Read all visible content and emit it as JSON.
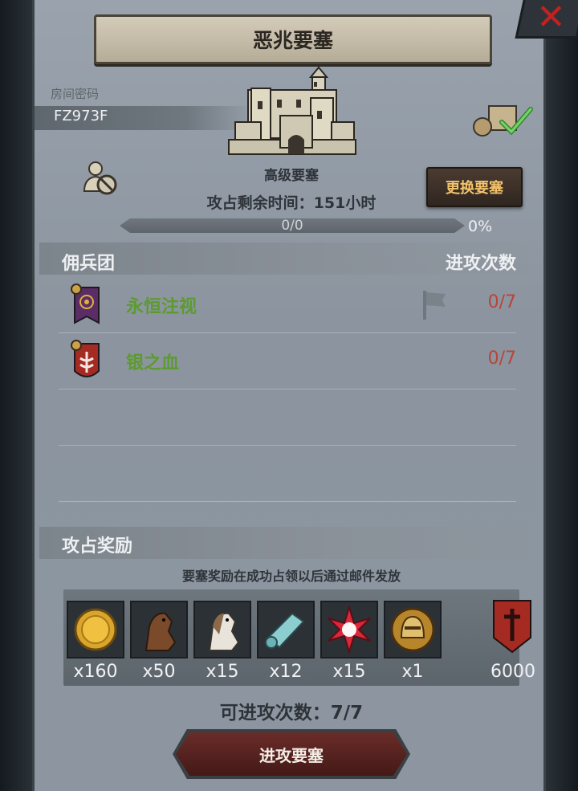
{
  "dialog": {
    "title": "恶兆要塞",
    "room_label": "房间密码",
    "room_code": "FZ973F",
    "fort_name": "高级要塞",
    "remaining_time": "攻占剩余时间：151小时",
    "change_button": "更换要塞",
    "progress_text": "0/0",
    "progress_percent": "0%",
    "progress_fraction": 0
  },
  "mercenaries": {
    "heading": "佣兵团",
    "attack_heading": "进攻次数",
    "rows": [
      {
        "name": "永恒注视",
        "count": "0/7",
        "banner_color": "#5b2d66"
      },
      {
        "name": "银之血",
        "count": "0/7",
        "banner_color": "#a52a22"
      }
    ]
  },
  "rewards": {
    "heading": "攻占奖励",
    "note": "要塞奖励在成功占领以后通过邮件发放",
    "items": [
      {
        "icon": "gold-coin-icon",
        "qty": "x160"
      },
      {
        "icon": "brown-horse-icon",
        "qty": "x50"
      },
      {
        "icon": "white-horse-icon",
        "qty": "x15"
      },
      {
        "icon": "cloth-scroll-icon",
        "qty": "x12"
      },
      {
        "icon": "star-crystal-icon",
        "qty": "x15"
      },
      {
        "icon": "knight-helmet-medal-icon",
        "qty": "x1"
      },
      {
        "icon": "guild-shield-icon",
        "qty": "6000"
      }
    ]
  },
  "footer": {
    "attack_count": "可进攻次数：7/7",
    "attack_button": "进攻要塞"
  },
  "colors": {
    "panel": "#8d96a0",
    "accent_gold": "#f3c36c",
    "name_green": "#5d9a30",
    "count_red": "#b8443a",
    "close_red": "#c32020"
  }
}
